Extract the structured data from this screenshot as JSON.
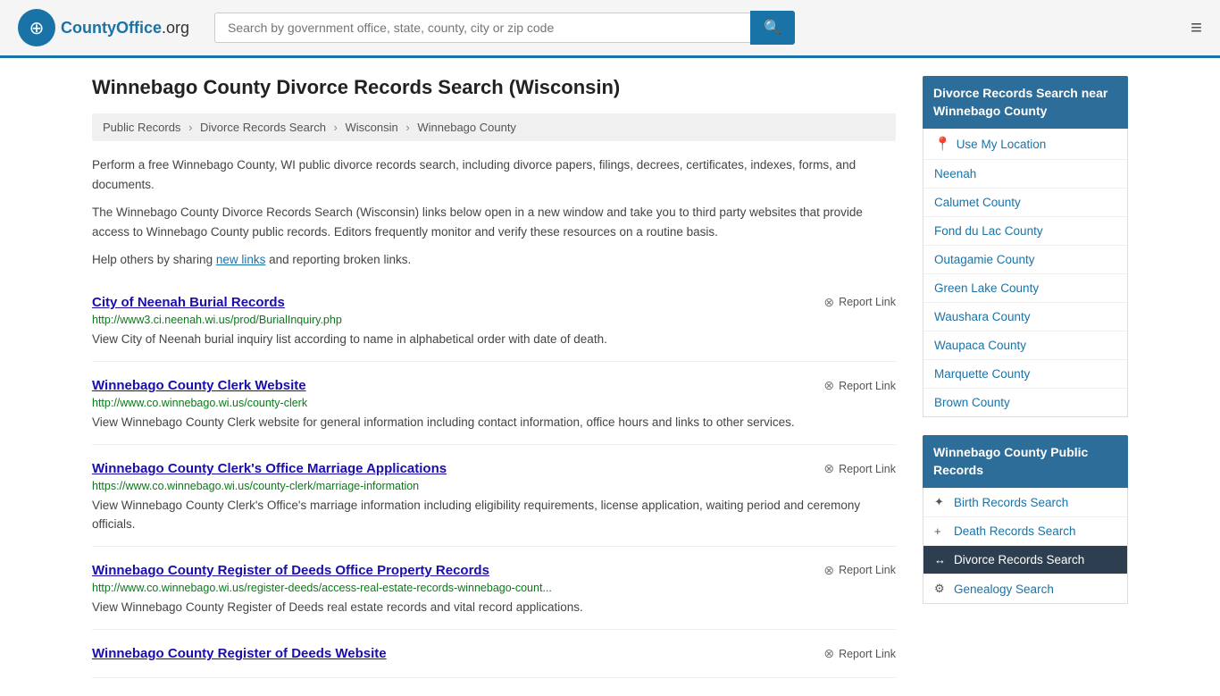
{
  "header": {
    "logo_text": "CountyOffice",
    "logo_org": ".org",
    "search_placeholder": "Search by government office, state, county, city or zip code"
  },
  "page": {
    "title": "Winnebago County Divorce Records Search (Wisconsin)"
  },
  "breadcrumb": {
    "items": [
      "Public Records",
      "Divorce Records Search",
      "Wisconsin",
      "Winnebago County"
    ]
  },
  "description": {
    "para1": "Perform a free Winnebago County, WI public divorce records search, including divorce papers, filings, decrees, certificates, indexes, forms, and documents.",
    "para2": "The Winnebago County Divorce Records Search (Wisconsin) links below open in a new window and take you to third party websites that provide access to Winnebago County public records. Editors frequently monitor and verify these resources on a routine basis.",
    "para3_before": "Help others by sharing ",
    "para3_link": "new links",
    "para3_after": " and reporting broken links."
  },
  "results": [
    {
      "title": "City of Neenah Burial Records",
      "url": "http://www3.ci.neenah.wi.us/prod/BurialInquiry.php",
      "desc": "View City of Neenah burial inquiry list according to name in alphabetical order with date of death.",
      "report": "Report Link"
    },
    {
      "title": "Winnebago County Clerk Website",
      "url": "http://www.co.winnebago.wi.us/county-clerk",
      "desc": "View Winnebago County Clerk website for general information including contact information, office hours and links to other services.",
      "report": "Report Link"
    },
    {
      "title": "Winnebago County Clerk's Office Marriage Applications",
      "url": "https://www.co.winnebago.wi.us/county-clerk/marriage-information",
      "desc": "View Winnebago County Clerk's Office's marriage information including eligibility requirements, license application, waiting period and ceremony officials.",
      "report": "Report Link"
    },
    {
      "title": "Winnebago County Register of Deeds Office Property Records",
      "url": "http://www.co.winnebago.wi.us/register-deeds/access-real-estate-records-winnebago-count...",
      "desc": "View Winnebago County Register of Deeds real estate records and vital record applications.",
      "report": "Report Link"
    },
    {
      "title": "Winnebago County Register of Deeds Website",
      "url": "",
      "desc": "",
      "report": "Report Link"
    }
  ],
  "sidebar": {
    "nearby_heading": "Divorce Records Search near Winnebago County",
    "use_location": "Use My Location",
    "nearby_items": [
      "Neenah",
      "Calumet County",
      "Fond du Lac County",
      "Outagamie County",
      "Green Lake County",
      "Waushara County",
      "Waupaca County",
      "Marquette County",
      "Brown County"
    ],
    "public_records_heading": "Winnebago County Public Records",
    "public_records_items": [
      {
        "label": "Birth Records Search",
        "icon": "✦",
        "active": false
      },
      {
        "label": "Death Records Search",
        "icon": "+",
        "active": false
      },
      {
        "label": "Divorce Records Search",
        "icon": "↔",
        "active": true
      },
      {
        "label": "Genealogy Search",
        "icon": "⚙",
        "active": false
      }
    ]
  }
}
